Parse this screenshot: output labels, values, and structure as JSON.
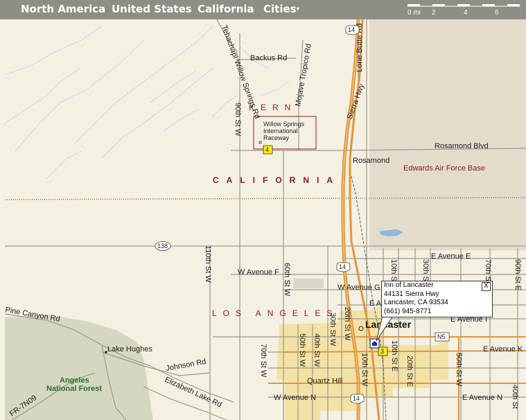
{
  "breadcrumbs": [
    {
      "label": "North America"
    },
    {
      "label": "United States"
    },
    {
      "label": "California"
    },
    {
      "label": "Cities",
      "has_dropdown": true
    }
  ],
  "scale": {
    "unit_label": "0 mi",
    "ticks": [
      "2",
      "4",
      "6"
    ]
  },
  "regions": {
    "kern": "KERN",
    "california": "CALIFORNIA",
    "los_angeles": "LOS ANGELES",
    "edwards": "Edwards Air Force Base",
    "forest_line1": "Angeles",
    "forest_line2": "National Forest"
  },
  "places": {
    "raceway_line1": "Willow Springs",
    "raceway_line2": "International",
    "raceway_line3": "Raceway",
    "rosamond": "Rosamond",
    "lancaster": "Lancaster",
    "quartz_hill": "Quartz Hill",
    "lake_hughes": "Lake Hughes"
  },
  "roads": {
    "backus": "Backus Rd",
    "tehachapi": "Tehachapi Willow Springs Rd",
    "mojave_tropico": "Mojave Tropico Rd",
    "lone_butte": "Lone Butte Rd",
    "sierra_hwy": "Sierra Hwy",
    "st_90w": "90th St W",
    "rosamond_blvd": "Rosamond Blvd",
    "ave_e": "E Avenue E",
    "ave_f": "W Avenue F",
    "ave_g": "W Avenue G",
    "ave_h": "E A",
    "ave_i": "E Avenue I",
    "ave_k": "E Avenue K",
    "ave_n_w": "W Avenue N",
    "ave_n_e": "E Avenue N",
    "st_110w": "110th St W",
    "st_60w": "60th St W",
    "st_20w": "20th St W",
    "st_30w": "30th St W",
    "st_40w": "40th St W",
    "st_50w": "50th St W",
    "st_70w": "70th St W",
    "st_10w": "10th St W",
    "st_10e_a": "10th St E",
    "st_30e": "30th St E",
    "st_70e": "70th St E",
    "st_90e": "90th St E",
    "st_10e_b": "10th St E",
    "st_20e": "20th St E",
    "st_50w_b": "50th St W",
    "st_40e": "40th St",
    "pine_canyon": "Pine Canyon Rd",
    "johnson": "Johnson Rd",
    "elizabeth_lake": "Elizabeth Lake Rd",
    "fr": "FR-7N09"
  },
  "shields": {
    "hwy14_top": "14",
    "hwy14_mid": "14",
    "hwy14_bottom": "14",
    "hwy138": "138",
    "n5": "N5",
    "marker4": "4",
    "marker3": "3"
  },
  "popup": {
    "name": "Inn of Lancaster",
    "address": "44131 Sierra Hwy",
    "city": "Lancaster, CA  93534",
    "phone": "(661) 945-8771",
    "close": "X"
  }
}
